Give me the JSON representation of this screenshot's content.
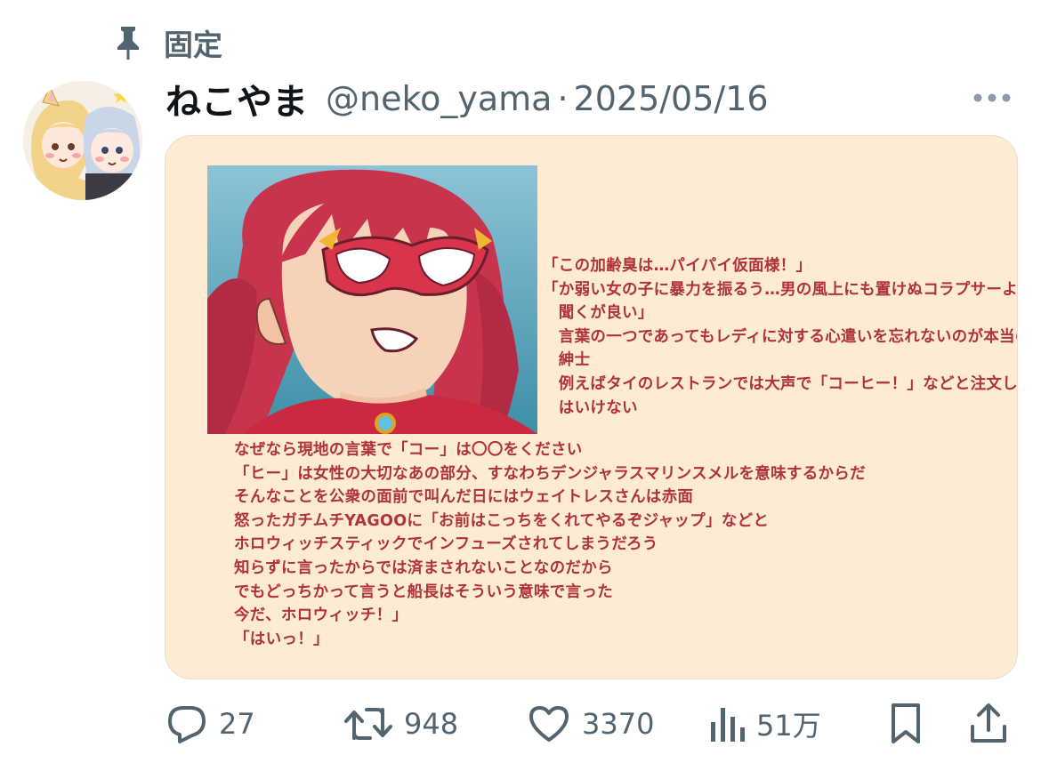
{
  "pinned": {
    "label": "固定"
  },
  "tweet": {
    "display_name": "ねこやま",
    "handle": "@neko_yama",
    "separator": "·",
    "date": "2025/05/16"
  },
  "media": {
    "caption_right": "「この加齢臭は…パイパイ仮面様！」\n「か弱い女の子に暴力を振るう…男の風上にも置けぬコラプサーよ\n　聞くが良い」\n　言葉の一つであってもレディに対する心遣いを忘れないのが本当の\n　紳士\n　例えばタイのレストランでは大声で「コーヒー！」などと注文して\n　はいけない",
    "caption_bottom": "なぜなら現地の言葉で「コー」は〇〇をください\n「ヒー」は女性の大切なあの部分、すなわちデンジャラスマリンスメルを意味するからだ\nそんなことを公衆の面前で叫んだ日にはウェイトレスさんは赤面\n怒ったガチムチYAGOOに「お前はこっちをくれてやるぞジャップ」などと\nホロウィッチスティックでインフューズされてしまうだろう\n知らずに言ったからでは済まされないことなのだから\nでもどっちかって言うと船長はそういう意味で言った\n今だ、ホロウィッチ！」\n「はいっ！」"
  },
  "actions": {
    "replies": "27",
    "retweets": "948",
    "likes": "3370",
    "views": "51万"
  },
  "colors": {
    "secondary_text": "#536471",
    "card_background": "#fdecd3",
    "caption_text": "#b0323a"
  },
  "icons": [
    "pin-icon",
    "more-icon",
    "reply-icon",
    "retweet-icon",
    "like-icon",
    "views-icon",
    "bookmark-icon",
    "share-icon"
  ]
}
